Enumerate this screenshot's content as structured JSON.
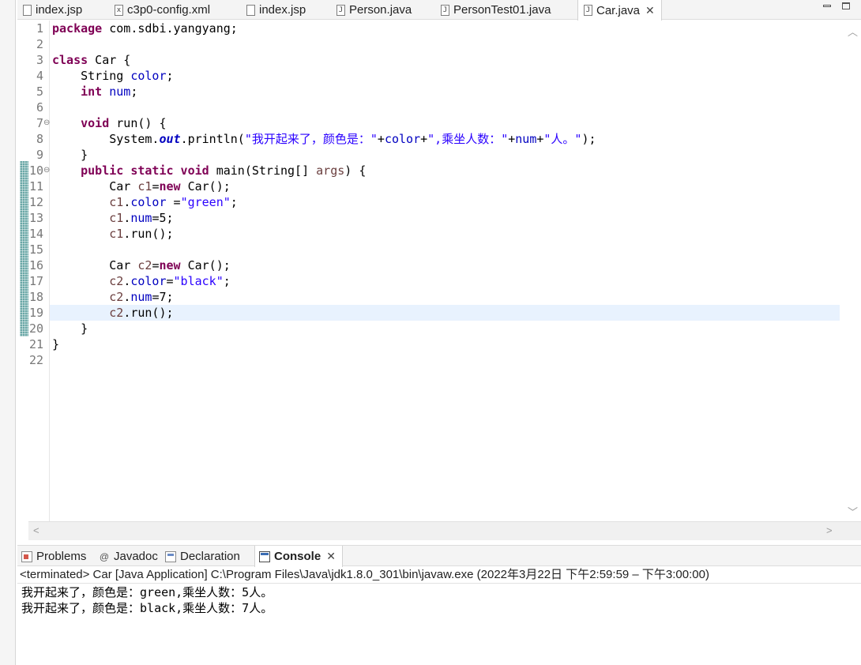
{
  "editor_tabs": [
    {
      "label": "index.jsp",
      "icon": "jsp-file-icon"
    },
    {
      "label": "c3p0-config.xml",
      "icon": "xml-file-icon"
    },
    {
      "label": "index.jsp",
      "icon": "jsp-file-icon"
    },
    {
      "label": "Person.java",
      "icon": "java-file-icon"
    },
    {
      "label": "PersonTest01.java",
      "icon": "java-file-icon"
    },
    {
      "label": "Car.java",
      "icon": "java-file-icon",
      "active": true
    }
  ],
  "code": {
    "line_numbers": [
      "1",
      "2",
      "3",
      "4",
      "5",
      "6",
      "7",
      "8",
      "9",
      "10",
      "11",
      "12",
      "13",
      "14",
      "15",
      "16",
      "17",
      "18",
      "19",
      "20",
      "21",
      "22"
    ],
    "current_line": "19",
    "lines": {
      "l1_kw": "package",
      "l1_rest": " com.sdbi.yangyang;",
      "l3_kw": "class",
      "l3_rest": " Car {",
      "l4_type": "    String ",
      "l4_field": "color",
      "l4_end": ";",
      "l5_kw": "    int",
      "l5_sp": " ",
      "l5_field": "num",
      "l5_end": ";",
      "l7_kw": "    void",
      "l7_rest": " run() {",
      "l8_a": "        System.",
      "l8_out": "out",
      "l8_b": ".println(",
      "l8_s1": "\"我开起来了，颜色是：\"",
      "l8_c": "+",
      "l8_f1": "color",
      "l8_d": "+",
      "l8_s2": "\",乘坐人数：\"",
      "l8_e": "+",
      "l8_f2": "num",
      "l8_g": "+",
      "l8_s3": "\"人。\"",
      "l8_h": ");",
      "l9": "    }",
      "l10_kw": "    public static void",
      "l10_a": " main(String[] ",
      "l10_var": "args",
      "l10_b": ") {",
      "l11_a": "        Car ",
      "l11_var": "c1",
      "l11_b": "=",
      "l11_kw": "new",
      "l11_c": " Car();",
      "l12_a": "        ",
      "l12_var": "c1",
      "l12_b": ".",
      "l12_field": "color",
      "l12_c": " =",
      "l12_str": "\"green\"",
      "l12_d": ";",
      "l13_a": "        ",
      "l13_var": "c1",
      "l13_b": ".",
      "l13_field": "num",
      "l13_c": "=5;",
      "l14_a": "        ",
      "l14_var": "c1",
      "l14_b": ".run();",
      "l16_a": "        Car ",
      "l16_var": "c2",
      "l16_b": "=",
      "l16_kw": "new",
      "l16_c": " Car();",
      "l17_a": "        ",
      "l17_var": "c2",
      "l17_b": ".",
      "l17_field": "color",
      "l17_c": "=",
      "l17_str": "\"black\"",
      "l17_d": ";",
      "l18_a": "        ",
      "l18_var": "c2",
      "l18_b": ".",
      "l18_field": "num",
      "l18_c": "=7;",
      "l19_a": "        ",
      "l19_var": "c2",
      "l19_b": ".run();",
      "l20": "    }",
      "l21": "}"
    }
  },
  "panel_tabs": [
    {
      "label": "Problems",
      "icon": "problems-icon"
    },
    {
      "label": "Javadoc",
      "icon": "javadoc-icon"
    },
    {
      "label": "Declaration",
      "icon": "declaration-icon"
    },
    {
      "label": "Console",
      "icon": "console-icon",
      "active": true
    }
  ],
  "console": {
    "header": "<terminated> Car [Java Application] C:\\Program Files\\Java\\jdk1.8.0_301\\bin\\javaw.exe  (2022年3月22日 下午2:59:59 – 下午3:00:00)",
    "output": [
      "我开起来了，颜色是：green,乘坐人数：5人。",
      "我开起来了，颜色是：black,乘坐人数：7人。"
    ]
  },
  "colors": {
    "keyword": "#7f0055",
    "field": "#0000c0",
    "string": "#2a00ff",
    "current_line": "#e8f2fe",
    "change_ruler": "#69a7a6"
  }
}
